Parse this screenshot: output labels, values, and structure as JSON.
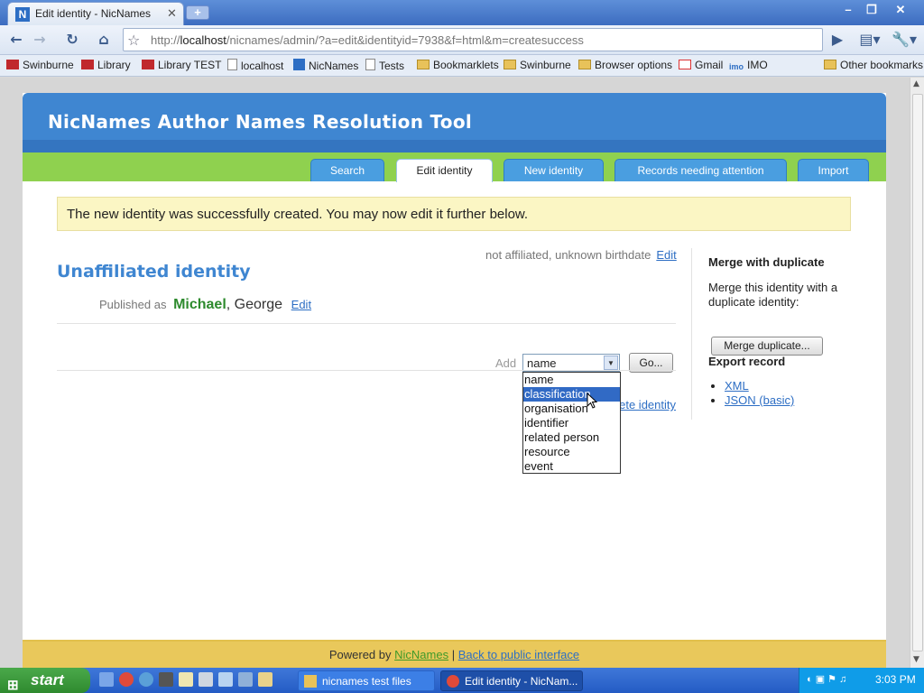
{
  "browser": {
    "tab_title": "Edit identity - NicNames",
    "tab_favicon": "N",
    "url_prefix": "http://",
    "url_host": "localhost",
    "url_path": "/nicnames/admin/?a=edit&identityid=7938&f=html&m=createsuccess"
  },
  "bookmarks": [
    {
      "label": "Swinburne",
      "icon": "swinburne-icon"
    },
    {
      "label": "Library",
      "icon": "swinburne-icon"
    },
    {
      "label": "Library TEST",
      "icon": "swinburne-icon"
    },
    {
      "label": "localhost",
      "icon": "page-icon"
    },
    {
      "label": "NicNames",
      "icon": "nicnames-icon"
    },
    {
      "label": "Tests",
      "icon": "page-icon"
    },
    {
      "label": "Bookmarklets",
      "icon": "folder-icon"
    },
    {
      "label": "Swinburne",
      "icon": "folder-icon"
    },
    {
      "label": "Browser options",
      "icon": "folder-icon"
    },
    {
      "label": "Gmail",
      "icon": "gmail-icon"
    },
    {
      "label": "IMO",
      "icon": "imo-icon"
    },
    {
      "label": "Other bookmarks",
      "icon": "folder-icon"
    }
  ],
  "app": {
    "title": "NicNames Author Names Resolution Tool",
    "nav": [
      {
        "label": "Search",
        "active": false
      },
      {
        "label": "Edit identity",
        "active": true
      },
      {
        "label": "New identity",
        "active": false
      },
      {
        "label": "Records needing attention",
        "active": false
      },
      {
        "label": "Import",
        "active": false
      }
    ],
    "notice": "The new identity was successfully created. You may now edit it further below."
  },
  "identity": {
    "affiliation_text": "not affiliated, unknown birthdate",
    "affiliation_edit": "Edit",
    "title": "Unaffiliated identity",
    "published_label": "Published as",
    "family_name": "Michael",
    "given_name": ", George",
    "name_edit": "Edit",
    "add_label": "Add",
    "add_selected": "name",
    "go_label": "Go...",
    "delete_link_visible": "A",
    "delete_link_tail": "ete identity",
    "add_options": [
      "name",
      "classification",
      "organisation",
      "identifier",
      "related person",
      "resource",
      "event"
    ],
    "highlighted_option": "classification"
  },
  "sidebar": {
    "merge_heading": "Merge with duplicate",
    "merge_text": "Merge this identity with a duplicate identity:",
    "merge_button": "Merge duplicate...",
    "export_heading": "Export record",
    "export_links": [
      "XML",
      "JSON (basic)"
    ]
  },
  "footer": {
    "powered_by": "Powered by",
    "brand": "NicNames",
    "separator": "|",
    "back_link": "Back to public interface"
  },
  "taskbar": {
    "start_label": "start",
    "tasks": [
      {
        "label": "nicnames test files",
        "active": false
      },
      {
        "label": "Edit identity - NicNam...",
        "active": true
      }
    ],
    "clock": "3:03 PM"
  },
  "colors": {
    "header_blue": "#3f86d1",
    "nav_green": "#8fd14f",
    "notice_yellow": "#fbf6c4",
    "footer_gold": "#e9c85b",
    "selection_blue": "#316ac5"
  }
}
